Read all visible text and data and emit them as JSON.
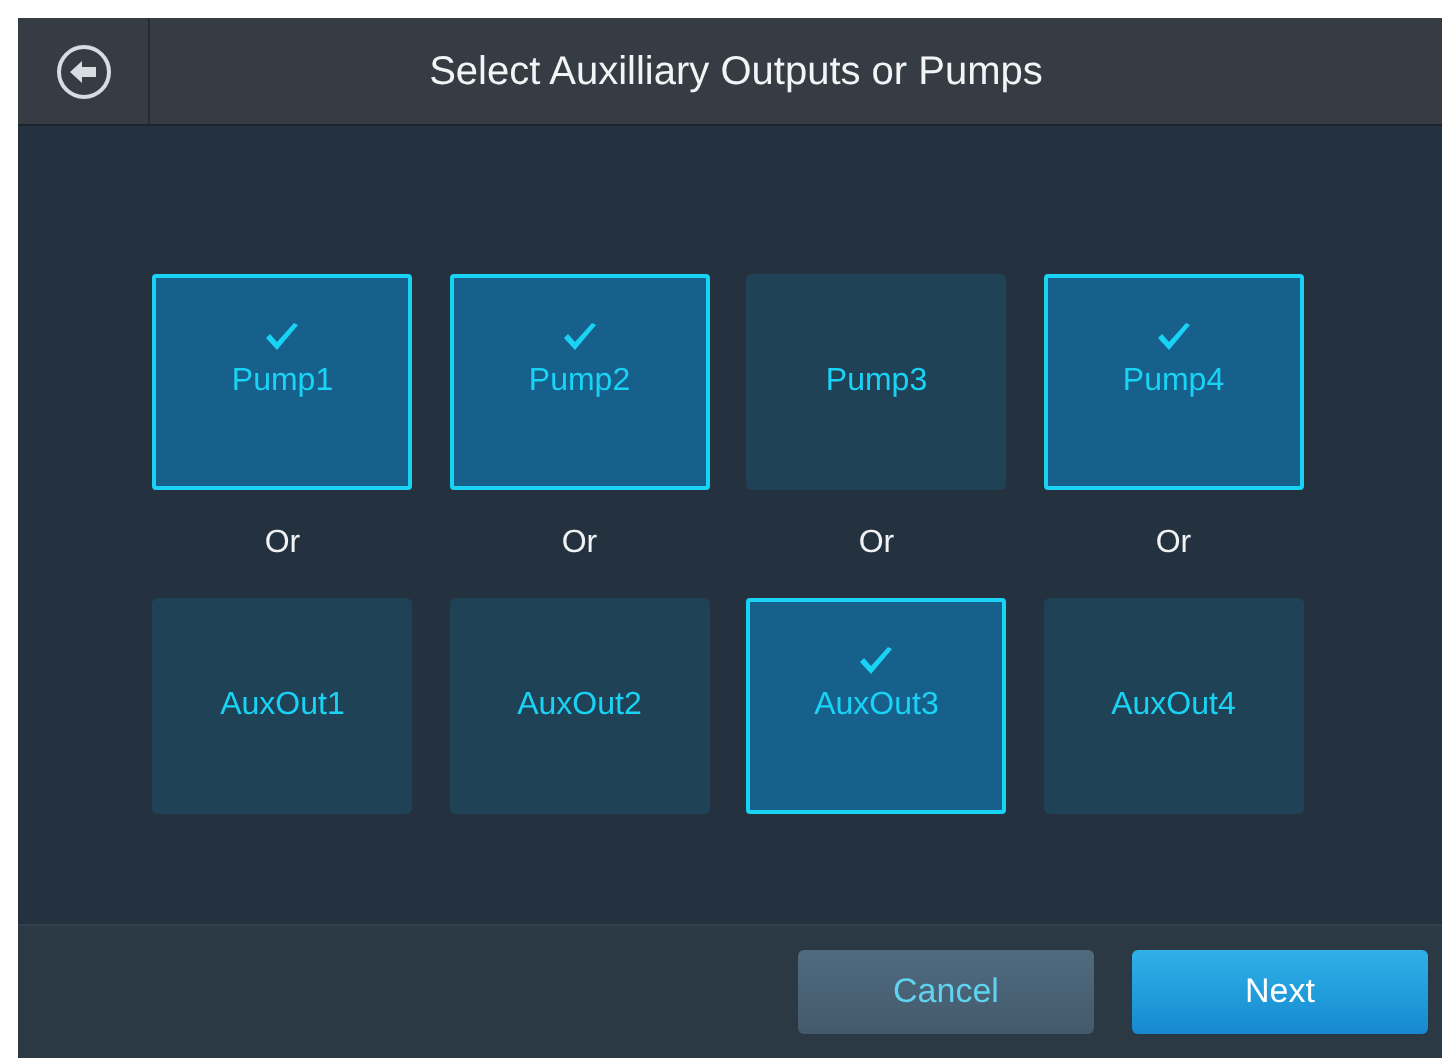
{
  "header": {
    "title": "Select Auxilliary Outputs or Pumps"
  },
  "pumps": [
    {
      "label": "Pump1",
      "selected": true
    },
    {
      "label": "Pump2",
      "selected": true
    },
    {
      "label": "Pump3",
      "selected": false
    },
    {
      "label": "Pump4",
      "selected": true
    }
  ],
  "separators": [
    "Or",
    "Or",
    "Or",
    "Or"
  ],
  "aux_outputs": [
    {
      "label": "AuxOut1",
      "selected": false
    },
    {
      "label": "AuxOut2",
      "selected": false
    },
    {
      "label": "AuxOut3",
      "selected": true
    },
    {
      "label": "AuxOut4",
      "selected": false
    }
  ],
  "buttons": {
    "cancel": "Cancel",
    "next": "Next"
  }
}
